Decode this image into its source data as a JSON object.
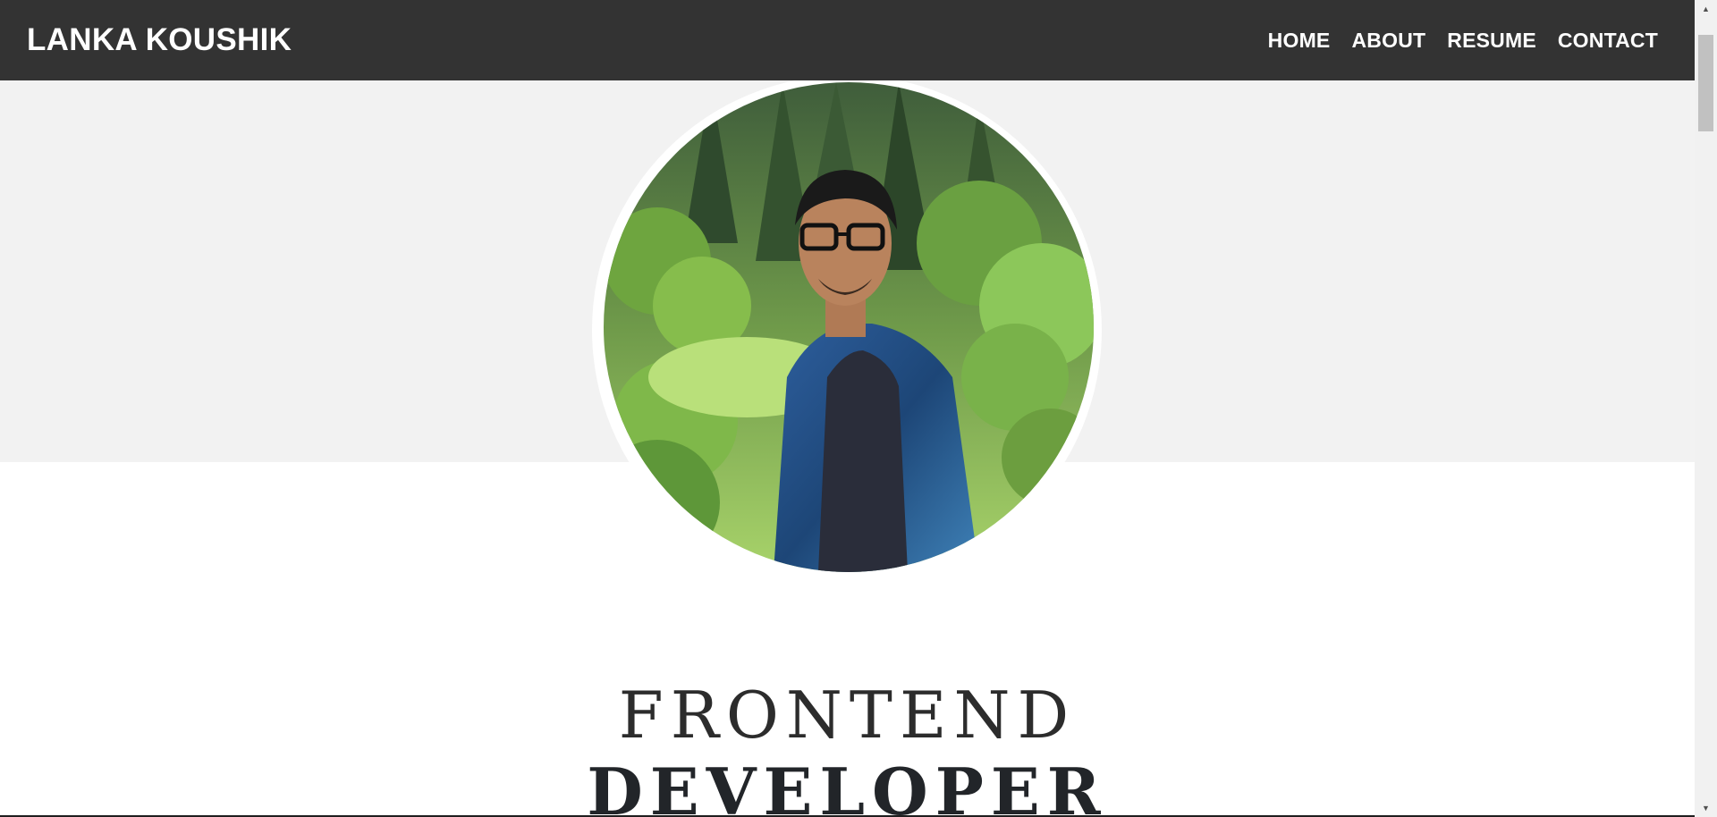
{
  "navbar": {
    "brand": "LANKA KOUSHIK",
    "links": [
      "HOME",
      "ABOUT",
      "RESUME",
      "CONTACT"
    ]
  },
  "hero": {
    "profile_photo_alt": "portrait of person in denim jacket in forest",
    "title_line1": "FRONTEND",
    "title_line2": "DEVELOPER"
  },
  "colors": {
    "navbar_bg": "#333333",
    "hero_band_bg": "#f2f2f2",
    "text_dark": "#222529"
  }
}
